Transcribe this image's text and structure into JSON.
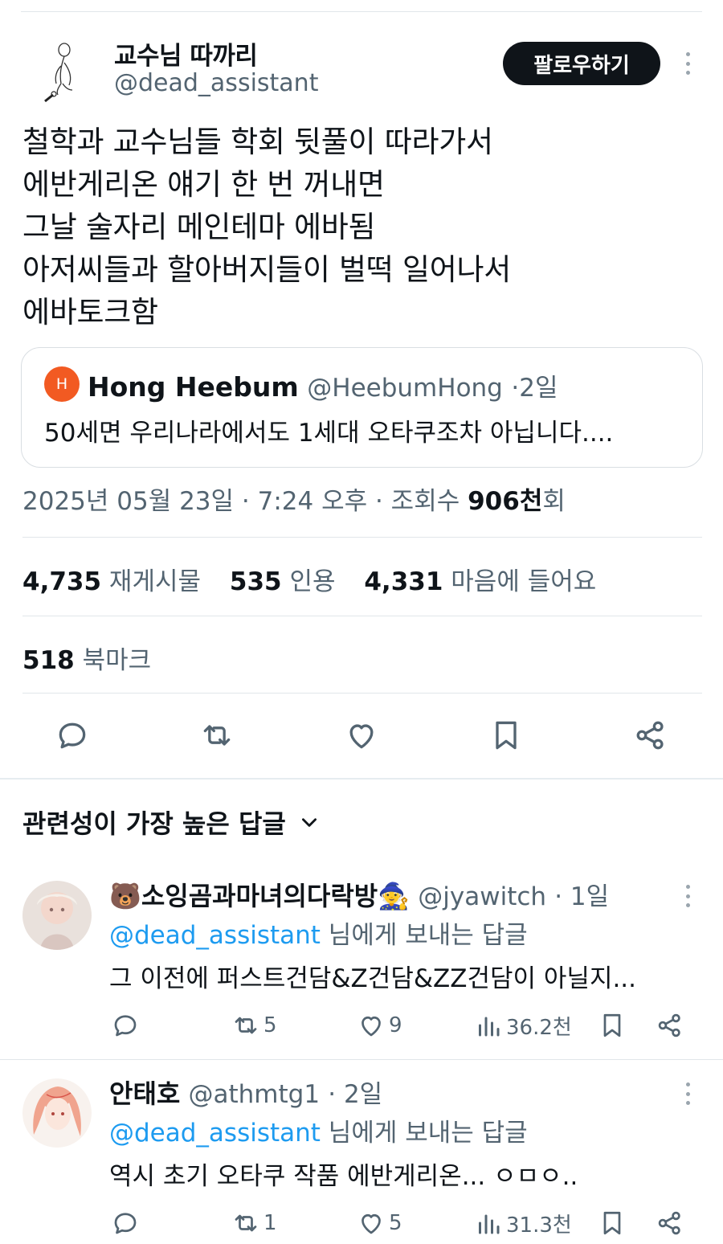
{
  "author": {
    "name": "교수님 따까리",
    "handle": "@dead_assistant",
    "follow_label": "팔로우하기",
    "avatar_icon": "stick-figure-drawing-icon"
  },
  "tweet": {
    "lines": [
      "철학과 교수님들 학회 뒷풀이 따라가서",
      "에반게리온 얘기 한 번 꺼내면",
      "그날 술자리 메인테마 에바됨",
      "아저씨들과 할아버지들이 벌떡 일어나서",
      "에바토크함"
    ]
  },
  "quote": {
    "avatar_letter": "H",
    "avatar_color": "#f25a22",
    "name": "Hong Heebum",
    "handle": "@HeebumHong",
    "sep": "·",
    "time": "2일",
    "text": "50세면 우리나라에서도 1세대 오타쿠조차 아닙니다...."
  },
  "meta": {
    "datetime": "2025년 05월 23일 · 7:24 오후 · 조회수 ",
    "views": "906천",
    "views_suffix": "회"
  },
  "stats": {
    "reposts_num": "4,735",
    "reposts_label": "재게시물",
    "quotes_num": "535",
    "quotes_label": "인용",
    "likes_num": "4,331",
    "likes_label": "마음에 들어요",
    "bookmarks_num": "518",
    "bookmarks_label": "북마크"
  },
  "actions": [
    "reply-icon",
    "repost-icon",
    "like-icon",
    "bookmark-icon",
    "share-icon"
  ],
  "sort": {
    "label": "관련성이 가장 높은 답글"
  },
  "replies": [
    {
      "name": "🐻소잉곰과마녀의다락방🧙",
      "handle": "@jyawitch",
      "time": "· 1일",
      "to_mention": "@dead_assistant",
      "to_suffix": " 님에게 보내는 답글",
      "text": "그 이전에 퍼스트건담&Z건담&ZZ건담이 아닐지...",
      "reposts": "5",
      "likes": "9",
      "views": "36.2천"
    },
    {
      "name": "안태호",
      "handle": "@athmtg1",
      "time": "· 2일",
      "to_mention": "@dead_assistant",
      "to_suffix": " 님에게 보내는 답글",
      "text": "역시 초기 오타쿠 작품 에반게리온... ㅇㅁㅇ..",
      "reposts": "1",
      "likes": "5",
      "views": "31.3천"
    }
  ],
  "colors": {
    "link": "#1d9bf0",
    "muted": "#536471",
    "text": "#0f1419"
  }
}
